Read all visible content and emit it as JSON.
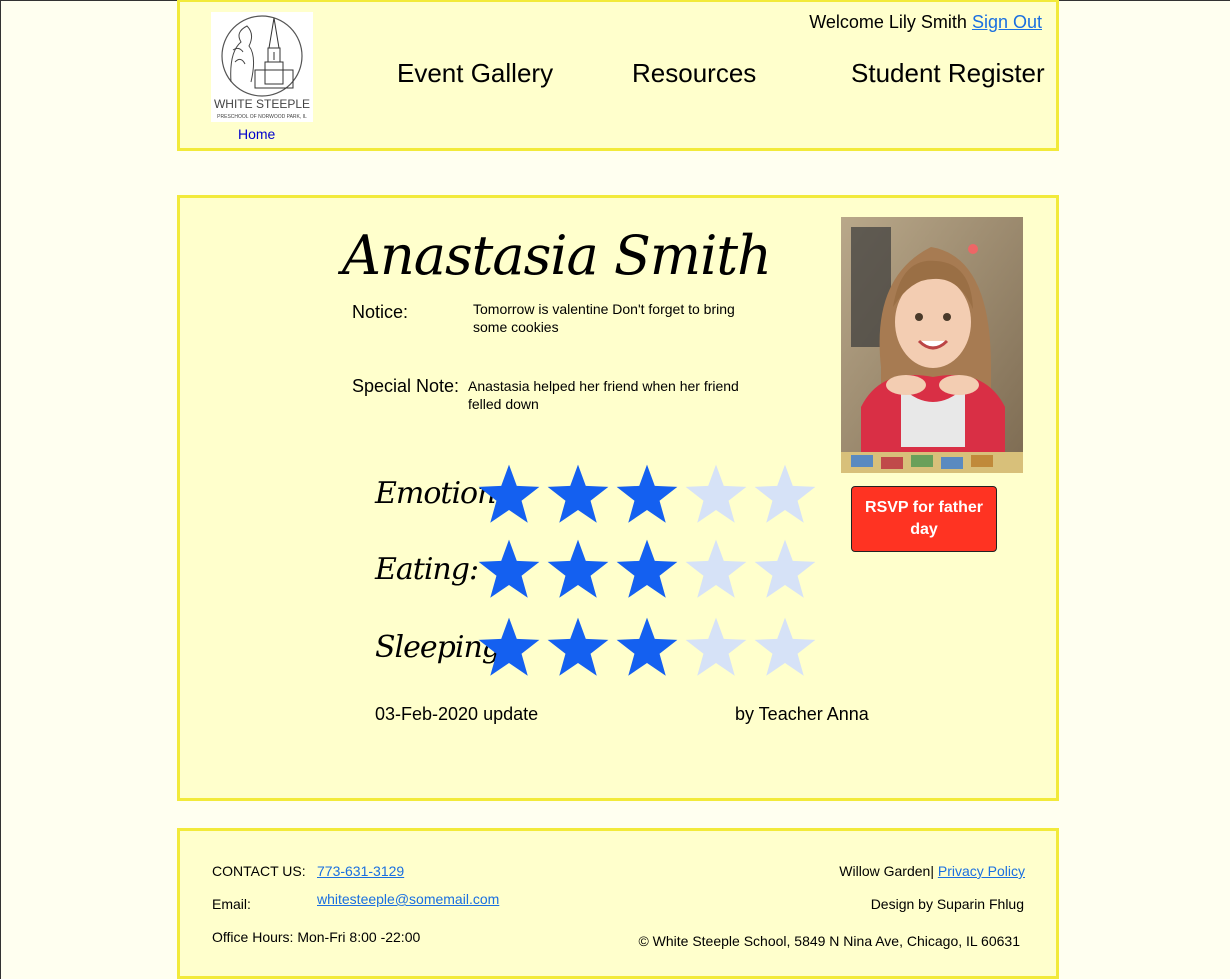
{
  "header": {
    "logo_text": "WHITE STEEPLE",
    "logo_subtext": "PRESCHOOL OF NORWOOD PARK, IL",
    "home_label": "Home",
    "welcome_text": "Welcome Lily Smith",
    "sign_out_label": "Sign Out",
    "nav": [
      "Event Gallery",
      "Resources",
      "Student Register"
    ]
  },
  "student": {
    "name": "Anastasia Smith",
    "notice_label": "Notice:",
    "notice_text": "Tomorrow is valentine Don't forget to bring some cookies",
    "special_label": "Special Note:",
    "special_text": "Anastasia helped her friend when her friend felled down",
    "rsvp_label": "RSVP for father day",
    "ratings": [
      {
        "label": "Emotion:",
        "stars": 3,
        "max": 5
      },
      {
        "label": "Eating:",
        "stars": 3,
        "max": 5
      },
      {
        "label": "Sleeping:",
        "stars": 3,
        "max": 5
      }
    ],
    "update_date": "03-Feb-2020 update",
    "update_by": "by Teacher Anna"
  },
  "colors": {
    "star_filled": "#1460f0",
    "star_empty": "#d6e2f7",
    "panel_bg": "#ffffcc",
    "panel_border": "#f2ea3a",
    "rsvp_bg": "#ff3322"
  },
  "footer": {
    "contact_label": "CONTACT US:",
    "phone": "773-631-3129",
    "email_label": "Email:",
    "email": "whitesteeple@somemail.com",
    "hours": "Office Hours: Mon-Fri 8:00 -22:00",
    "willow": "Willow Garden|",
    "privacy_label": "Privacy Policy",
    "design_by": "Design by Suparin Fhlug",
    "copyright": "© White Steeple School, 5849 N Nina Ave, Chicago, IL 60631"
  }
}
